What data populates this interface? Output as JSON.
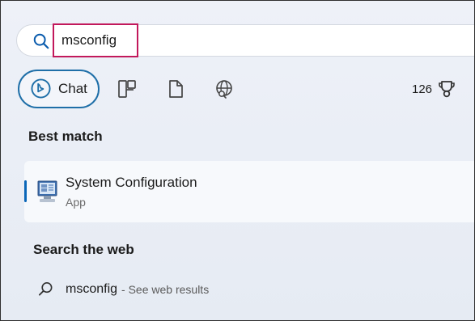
{
  "search": {
    "query": "msconfig"
  },
  "chips": {
    "chat_label": "Chat",
    "filters": [
      {
        "icon": "apps-grid-icon"
      },
      {
        "icon": "document-icon"
      },
      {
        "icon": "web-globe-icon"
      }
    ]
  },
  "rewards": {
    "points": "126",
    "icon": "trophy-icon"
  },
  "best_match": {
    "heading": "Best match",
    "title": "System Configuration",
    "subtitle": "App"
  },
  "web": {
    "heading": "Search the web",
    "query": "msconfig",
    "suffix": "- See web results"
  },
  "colors": {
    "accent": "#0a66b8",
    "highlight_box": "#c2185b",
    "chat_border": "#1f6fa8"
  }
}
